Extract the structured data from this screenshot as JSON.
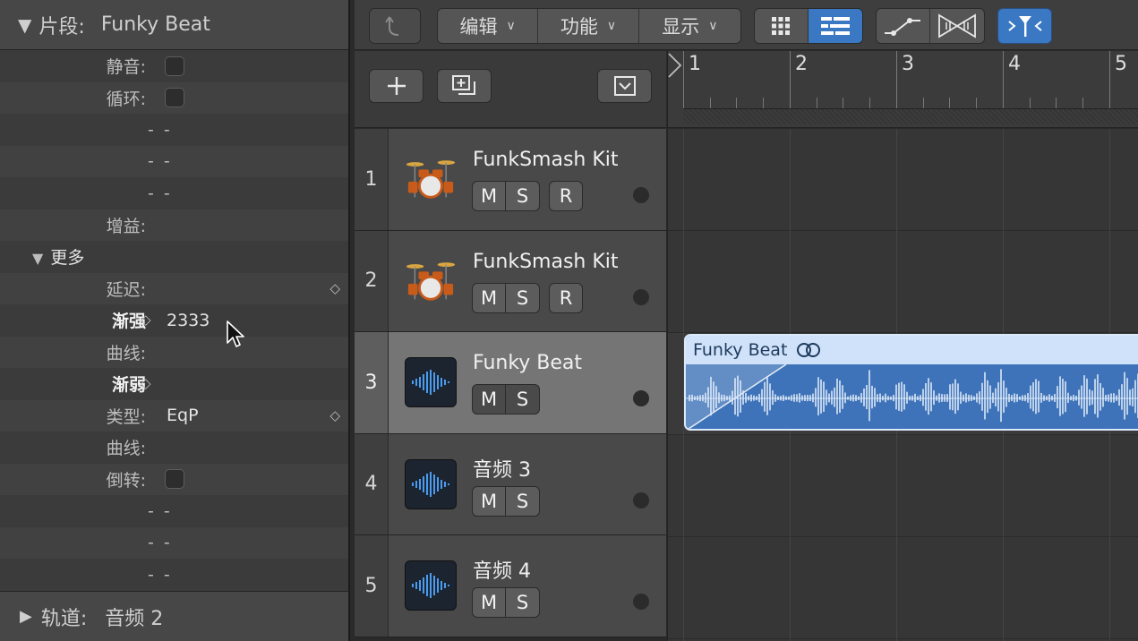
{
  "inspector": {
    "header_title": "片段:",
    "header_value": "Funky Beat",
    "mute_label": "静音:",
    "loop_label": "循环:",
    "dash": "--",
    "gain_label": "增益:",
    "more_label": "更多",
    "delay_label": "延迟:",
    "fadein_label": "渐强",
    "fadein_value": "2333",
    "curve_label": "曲线:",
    "fadeout_label": "渐弱",
    "type_label": "类型:",
    "type_value": "EqP",
    "reverse_label": "倒转:",
    "footer_title": "轨道:",
    "footer_value": "音频 2"
  },
  "toolbar": {
    "edit_label": "编辑",
    "functions_label": "功能",
    "view_label": "显示"
  },
  "ruler": {
    "bars": [
      "1",
      "2",
      "3",
      "4",
      "5"
    ]
  },
  "tracks": [
    {
      "number": "1",
      "name": "FunkSmash Kit",
      "icon": "drum-kit-icon",
      "mute": "M",
      "solo": "S",
      "record": "R"
    },
    {
      "number": "2",
      "name": "FunkSmash Kit",
      "icon": "drum-kit-icon",
      "mute": "M",
      "solo": "S",
      "record": "R"
    },
    {
      "number": "3",
      "name": "Funky Beat",
      "icon": "audio-waveform-icon",
      "mute": "M",
      "solo": "S",
      "selected": true
    },
    {
      "number": "4",
      "name": "音频 3",
      "icon": "audio-waveform-icon",
      "mute": "M",
      "solo": "S"
    },
    {
      "number": "5",
      "name": "音频 4",
      "icon": "audio-waveform-icon",
      "mute": "M",
      "solo": "S"
    }
  ],
  "region": {
    "name": "Funky Beat",
    "loop_icon": "loop-rings-icon"
  },
  "colors": {
    "accent": "#3a78c4",
    "region_header": "#cfe2fa",
    "region_body": "#3e73b9"
  }
}
